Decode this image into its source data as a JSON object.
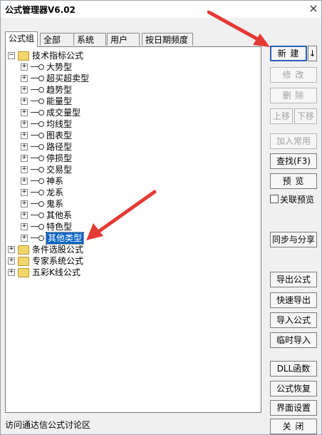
{
  "window": {
    "title": "公式管理器V6.02",
    "close_icon": "×"
  },
  "tabs": [
    {
      "label": "公式组",
      "active": true
    },
    {
      "label": "全部",
      "active": false
    },
    {
      "label": "系统",
      "active": false
    },
    {
      "label": "用户",
      "active": false
    },
    {
      "label": "按日期频度",
      "active": false
    }
  ],
  "tree": {
    "root_label": "技术指标公式",
    "root_expander": "−",
    "child_expander": "+",
    "children": [
      "大势型",
      "超买超卖型",
      "趋势型",
      "能量型",
      "成交量型",
      "均线型",
      "图表型",
      "路径型",
      "停损型",
      "交易型",
      "神系",
      "龙系",
      "鬼系",
      "其他系",
      "特色型",
      "其他类型"
    ],
    "selected": "其他类型",
    "other_roots": [
      "条件选股公式",
      "专家系统公式",
      "五彩K线公式"
    ]
  },
  "buttons": {
    "new": "新 建",
    "new_dropdown": "↓",
    "modify": "修 改",
    "delete": "删 除",
    "move_up": "上移",
    "move_down": "下移",
    "add_common": "加入常用",
    "find": "查找(F3)",
    "preview": "预 览",
    "linked_preview": "关联预览",
    "sync_share": "同步与分享",
    "export": "导出公式",
    "quick_export": "快速导出",
    "import": "导入公式",
    "temp_import": "临时导入",
    "dll": "DLL函数",
    "restore": "公式恢复",
    "ui_settings": "界面设置",
    "close": "关 闭"
  },
  "status": {
    "forum_link": "访问通达信公式讨论区"
  },
  "annotation_color": "#e53935"
}
